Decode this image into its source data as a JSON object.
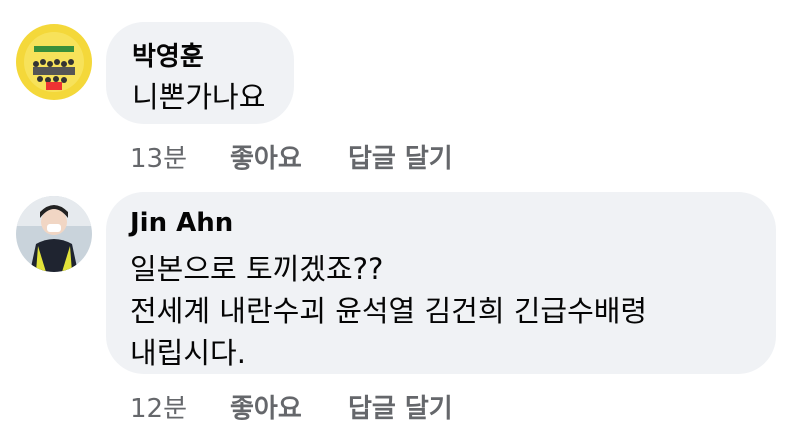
{
  "comments": [
    {
      "author": "박영훈",
      "lines": [
        "니뽄가나요"
      ],
      "time": "13분",
      "like_label": "좋아요",
      "reply_label": "답글 달기",
      "avatar_icon": "profile-photo-yellow-group"
    },
    {
      "author": "Jin Ahn",
      "lines": [
        "일본으로 토끼겠죠??",
        "전세계 내란수괴 윤석열 김건희 긴급수배령",
        "내립시다."
      ],
      "time": "12분",
      "like_label": "좋아요",
      "reply_label": "답글 달기",
      "avatar_icon": "profile-photo-person-in-vest"
    }
  ],
  "colors": {
    "bubble": "#f0f2f5",
    "text": "#050505",
    "meta": "#65676b"
  }
}
